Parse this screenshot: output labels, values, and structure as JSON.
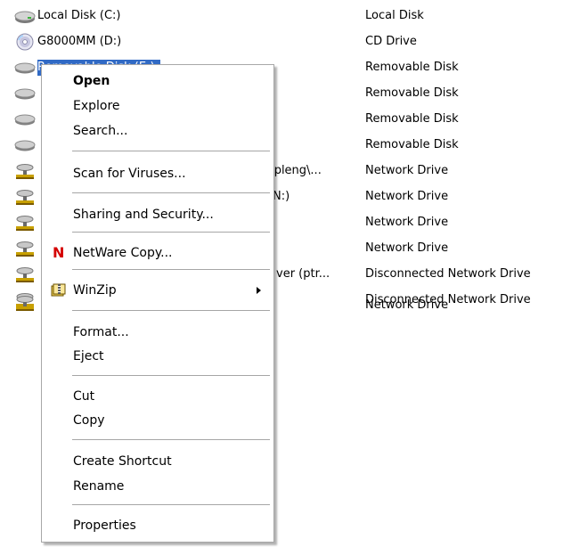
{
  "drives": [
    {
      "name": "Local Disk (C:)",
      "type": "Local Disk",
      "icon": "hard-disk-icon",
      "selected": false
    },
    {
      "name": "G8000MM (D:)",
      "type": "CD Drive",
      "icon": "cd-drive-icon",
      "selected": false
    },
    {
      "name": "Removable Disk (E:)",
      "type": "Removable Disk",
      "icon": "removable-disk-icon",
      "selected": true
    },
    {
      "name": "",
      "type": "Removable Disk",
      "icon": "removable-disk-icon",
      "selected": false
    },
    {
      "name": "",
      "type": "Removable Disk",
      "icon": "removable-disk-icon",
      "selected": false
    },
    {
      "name": "",
      "type": "Removable Disk",
      "icon": "removable-disk-icon",
      "selected": false
    },
    {
      "name": "vpleng\\...",
      "type": "Network Drive",
      "icon": "network-drive-icon",
      "selected": false
    },
    {
      "name": "N:)",
      "type": "Network Drive",
      "icon": "network-drive-icon",
      "selected": false
    },
    {
      "name": "",
      "type": "Network Drive",
      "icon": "network-drive-icon",
      "selected": false
    },
    {
      "name": "",
      "type": "Network Drive",
      "icon": "network-drive-icon",
      "selected": false
    },
    {
      "name": "ver (ptr...",
      "type": "Disconnected Network Drive",
      "icon": "network-drive-icon",
      "selected": false
    },
    {
      "name": "",
      "type": "Disconnected Network Drive",
      "icon": "network-drive-icon",
      "selected": false
    },
    {
      "name": "",
      "type": "Network Drive",
      "icon": "network-drive-icon",
      "selected": false
    }
  ],
  "context_menu": {
    "items": [
      {
        "label": "Open",
        "bold": true
      },
      {
        "label": "Explore"
      },
      {
        "label": "Search..."
      },
      {
        "label": "Scan for Viruses..."
      },
      {
        "label": "Sharing and Security..."
      },
      {
        "label": "NetWare Copy...",
        "icon": "netware-n-icon"
      },
      {
        "label": "WinZip",
        "icon": "winzip-icon",
        "submenu": true
      },
      {
        "label": "Format..."
      },
      {
        "label": "Eject"
      },
      {
        "label": "Cut"
      },
      {
        "label": "Copy"
      },
      {
        "label": "Create Shortcut"
      },
      {
        "label": "Rename"
      },
      {
        "label": "Properties"
      }
    ],
    "netware_glyph": "N"
  },
  "colors": {
    "selection": "#316ac5",
    "netware_red": "#d40000"
  }
}
